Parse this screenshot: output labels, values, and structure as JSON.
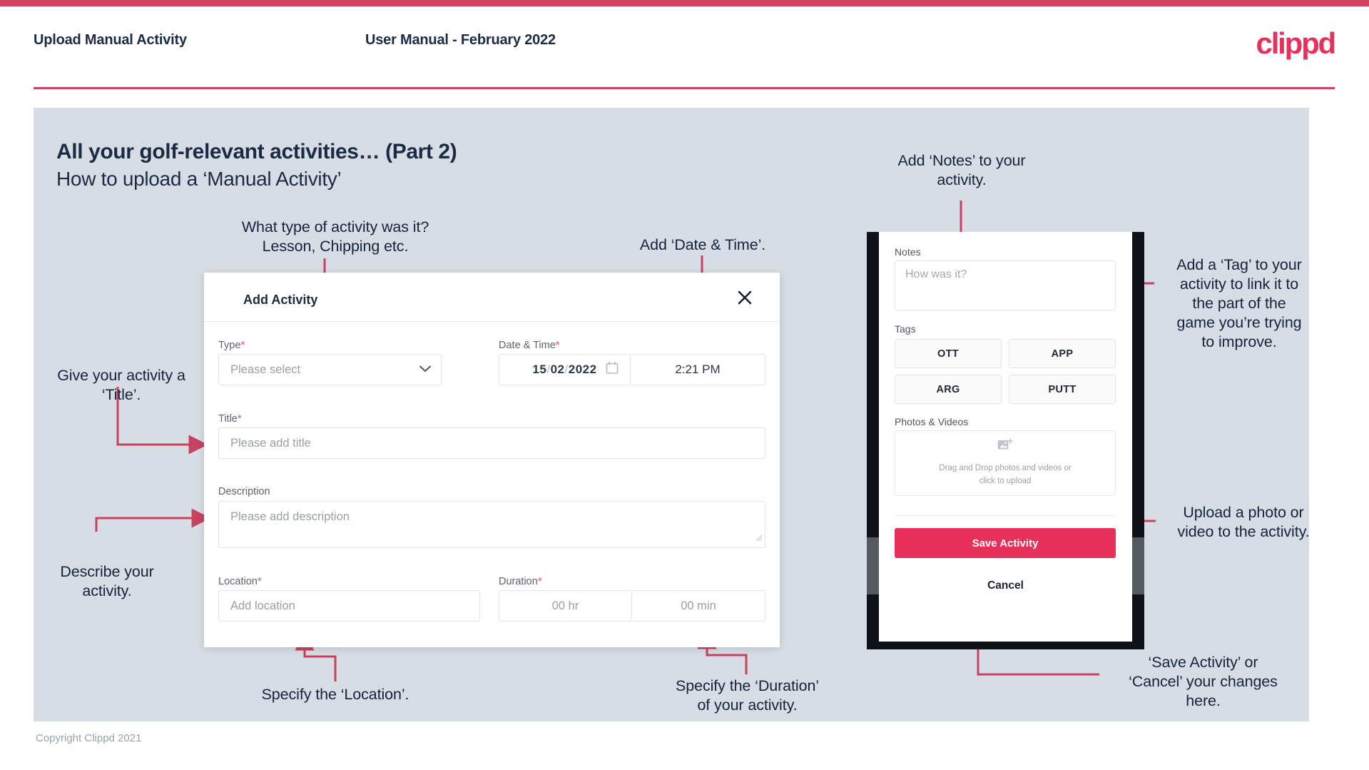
{
  "header": {
    "left_title": "Upload Manual Activity",
    "center_title": "User Manual - February 2022",
    "logo": "clippd"
  },
  "slide": {
    "title": "All your golf-relevant activities… (Part 2)",
    "subtitle": "How to upload a ‘Manual Activity’",
    "copyright": "Copyright Clippd 2021"
  },
  "annotations": {
    "type_note": "What type of activity was it?\nLesson, Chipping etc.",
    "datetime_note": "Add ‘Date & Time’.",
    "title_note": "Give your activity a\n‘Title’.",
    "description_note": "Describe your\nactivity.",
    "location_note": "Specify the ‘Location’.",
    "duration_note": "Specify the ‘Duration’\nof your activity.",
    "notes_note": "Add ‘Notes’ to your\nactivity.",
    "tags_note": "Add a ‘Tag’ to your\nactivity to link it to\nthe part of the\ngame you’re trying\nto improve.",
    "upload_note": "Upload a photo or\nvideo to the activity.",
    "save_note": "‘Save Activity’ or\n‘Cancel’ your changes\nhere."
  },
  "dialog": {
    "title": "Add Activity",
    "close_icon": "close-icon",
    "fields": {
      "type": {
        "label": "Type",
        "required": "*",
        "placeholder": "Please select",
        "icon": "chevron-down-icon"
      },
      "datetime": {
        "label": "Date & Time",
        "required": "*",
        "day": "15",
        "month": "02",
        "year": "2022",
        "separator": "/",
        "calendar_icon": "calendar-icon",
        "time": "2:21 PM"
      },
      "title": {
        "label": "Title",
        "required": "*",
        "placeholder": "Please add title"
      },
      "description": {
        "label": "Description",
        "required": "",
        "placeholder": "Please add description"
      },
      "location": {
        "label": "Location",
        "required": "*",
        "placeholder": "Add location"
      },
      "duration": {
        "label": "Duration",
        "required": "*",
        "hours": "00 hr",
        "minutes": "00 min"
      }
    }
  },
  "phone": {
    "notes": {
      "label": "Notes",
      "placeholder": "How was it?"
    },
    "tags": {
      "label": "Tags",
      "items": [
        "OTT",
        "APP",
        "ARG",
        "PUTT"
      ]
    },
    "photos": {
      "label": "Photos & Videos",
      "icon": "add-image-icon",
      "dropzone_text": "Drag and Drop photos and videos or\nclick to upload"
    },
    "save_label": "Save Activity",
    "cancel_label": "Cancel"
  },
  "colors": {
    "brand_pink": "#e8315a",
    "rule_pink": "#cf4360",
    "slide_bg": "#d7dde5",
    "navy": "#1c2b45",
    "connector": "#c8415f"
  }
}
